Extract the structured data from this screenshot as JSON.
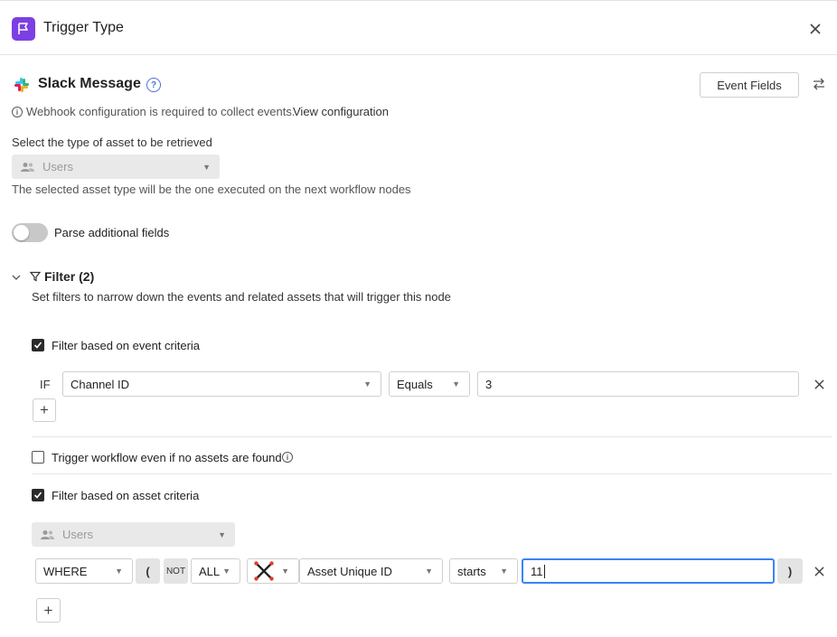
{
  "header": {
    "title": "Trigger Type",
    "icon": "flag-icon",
    "accent_color": "#7b3fe4"
  },
  "source": {
    "name": "Slack Message",
    "help_icon": "?",
    "event_fields_label": "Event Fields",
    "webhook_note": "Webhook configuration is required to collect events.",
    "view_config_label": "View configuration"
  },
  "asset_type": {
    "label": "Select the type of asset to be retrieved",
    "selected": "Users",
    "help_text": "The selected asset type will be the one executed on the next workflow nodes"
  },
  "parse": {
    "label": "Parse additional fields",
    "enabled": false
  },
  "filter": {
    "title": "Filter (2)",
    "description": "Set filters to narrow down the events and related assets that will trigger this node",
    "event_criteria": {
      "label": "Filter based on event criteria",
      "checked": true,
      "if_label": "IF",
      "field": "Channel ID",
      "operator": "Equals",
      "value": "3"
    },
    "trigger_no_assets": {
      "label": "Trigger workflow even if no assets are found",
      "checked": false
    },
    "asset_criteria": {
      "label": "Filter based on asset criteria",
      "checked": true,
      "asset_type": "Users",
      "where": "WHERE",
      "open_paren": "(",
      "not_label": "NOT",
      "quantifier": "ALL",
      "field": "Asset Unique ID",
      "operator": "starts",
      "value": "11",
      "close_paren": ")"
    }
  }
}
